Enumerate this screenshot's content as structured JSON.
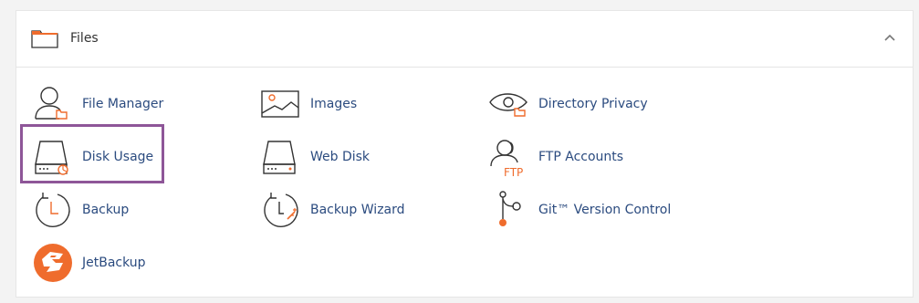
{
  "section": {
    "title": "Files",
    "folder_icon": "folder-icon",
    "collapse_icon": "chevron-up-icon"
  },
  "colors": {
    "accent": "#ef6c2d",
    "link": "#2b4b7f",
    "highlight": "#8e5698"
  },
  "items": [
    {
      "label": "File Manager",
      "icon": "file-manager-icon"
    },
    {
      "label": "Images",
      "icon": "images-icon"
    },
    {
      "label": "Directory Privacy",
      "icon": "directory-privacy-icon"
    },
    {
      "label": "Disk Usage",
      "icon": "disk-usage-icon"
    },
    {
      "label": "Web Disk",
      "icon": "web-disk-icon"
    },
    {
      "label": "FTP Accounts",
      "icon": "ftp-accounts-icon",
      "icon_text": "FTP"
    },
    {
      "label": "Backup",
      "icon": "backup-icon"
    },
    {
      "label": "Backup Wizard",
      "icon": "backup-wizard-icon"
    },
    {
      "label": "Git™ Version Control",
      "icon": "git-version-control-icon"
    },
    {
      "label": "JetBackup",
      "icon": "jetbackup-icon"
    }
  ]
}
